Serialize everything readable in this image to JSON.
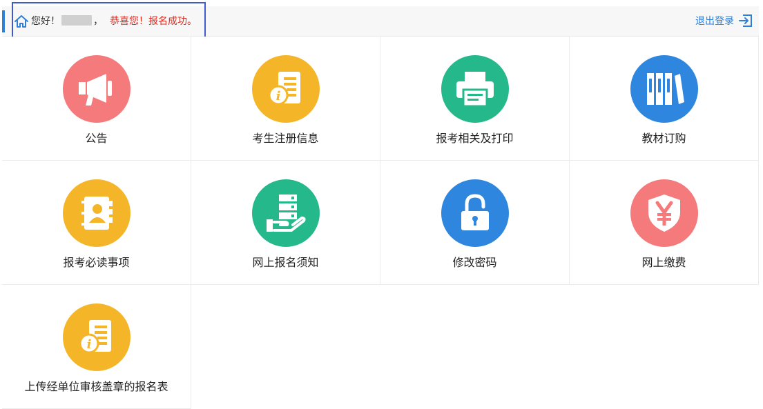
{
  "header": {
    "greeting": "您好！",
    "comma": "，",
    "success_message": "恭喜您！报名成功。",
    "logout_label": "退出登录"
  },
  "tiles": [
    {
      "label": "公告",
      "icon": "megaphone-icon",
      "color": "#f47a7b"
    },
    {
      "label": "考生注册信息",
      "icon": "info-document-icon",
      "color": "#f4b628"
    },
    {
      "label": "报考相关及打印",
      "icon": "printer-icon",
      "color": "#25b88a"
    },
    {
      "label": "教材订购",
      "icon": "books-icon",
      "color": "#2f86de"
    },
    {
      "label": "报考必读事项",
      "icon": "contact-book-icon",
      "color": "#f4b628"
    },
    {
      "label": "网上报名须知",
      "icon": "server-hand-icon",
      "color": "#25b88a"
    },
    {
      "label": "修改密码",
      "icon": "padlock-icon",
      "color": "#2f86de"
    },
    {
      "label": "网上缴费",
      "icon": "yen-shield-icon",
      "color": "#f47a7b"
    },
    {
      "label": "上传经单位审核盖章的报名表",
      "icon": "info-document-icon",
      "color": "#f4b628"
    }
  ]
}
